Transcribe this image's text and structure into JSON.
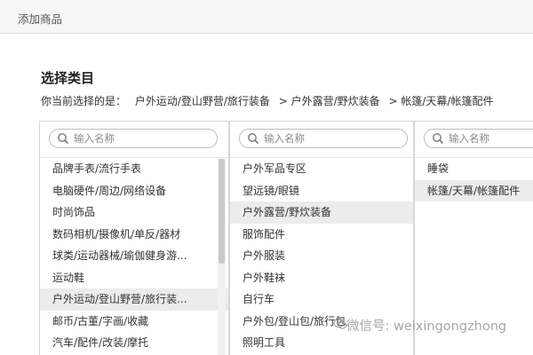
{
  "window": {
    "title": "添加商品"
  },
  "section": {
    "title": "选择类目"
  },
  "path": {
    "prefix": "你当前选择的是：",
    "crumbs": [
      "户外运动/登山野营/旅行装备",
      "> 户外露营/野炊装备",
      "> 帐篷/天幕/帐篷配件"
    ]
  },
  "columns": [
    {
      "search_placeholder": "输入名称",
      "items": [
        "品牌手表/流行手表",
        "电脑硬件/周边/网络设备",
        "时尚饰品",
        "数码相机/摄像机/单反/器材",
        "球类/运动器械/瑜伽健身游...",
        "运动鞋",
        "户外运动/登山野营/旅行装...",
        "邮币/古董/字画/收藏",
        "汽车/配件/改装/摩托"
      ],
      "selected_index": 6
    },
    {
      "search_placeholder": "输入名称",
      "items": [
        "户外军品专区",
        "望远镜/眼镜",
        "户外露营/野炊装备",
        "服饰配件",
        "户外服装",
        "户外鞋袜",
        "自行车",
        "户外包/登山包/旅行包",
        "照明工具"
      ],
      "selected_index": 2
    },
    {
      "search_placeholder": "输入名称",
      "items": [
        "睡袋",
        "帐篷/天幕/帐篷配件"
      ],
      "selected_index": 1
    }
  ],
  "watermark": {
    "text": "微信号: weixingongzhong"
  },
  "colors": {
    "selected_bg": "#ececec",
    "border": "#d7d7d7",
    "topbar_bg": "#f6f6f6"
  }
}
